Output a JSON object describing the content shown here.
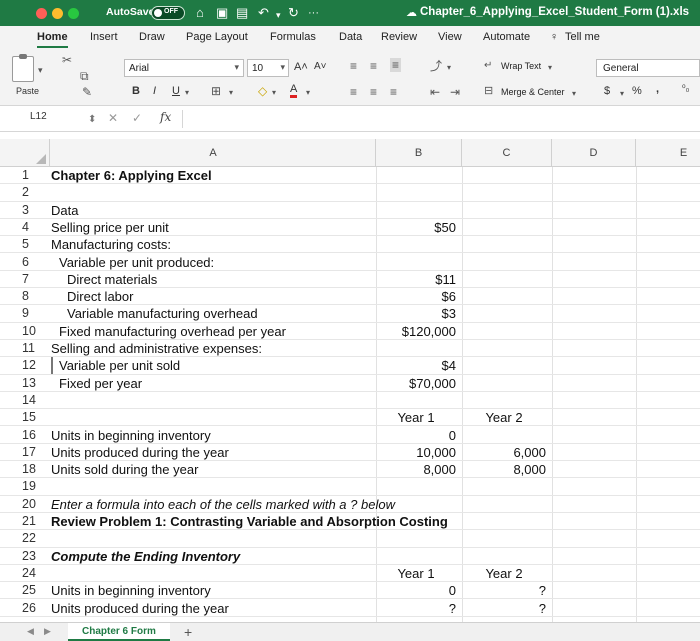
{
  "titlebar": {
    "autosave_label": "AutoSave",
    "autosave_state": "OFF",
    "more": "···",
    "document_title": "Chapter_6_Applying_Excel_Student_Form (1).xls"
  },
  "menu": {
    "tabs": [
      "Home",
      "Insert",
      "Draw",
      "Page Layout",
      "Formulas",
      "Data",
      "Review",
      "View",
      "Automate"
    ],
    "active": "Home",
    "tell_me": "Tell me"
  },
  "ribbon": {
    "paste_label": "Paste",
    "font_name": "Arial",
    "font_size": "10",
    "grow_font": "A˄",
    "shrink_font": "A˅",
    "bold": "B",
    "italic": "I",
    "underline": "U",
    "font_color": "A",
    "wrap_text": "Wrap Text",
    "merge_center": "Merge & Center",
    "number_format": "General",
    "currency": "$",
    "percent": "%",
    "comma": ",",
    "inc_decimal": "⁰₀"
  },
  "formula_bar": {
    "name_box": "L12",
    "fx": "fx"
  },
  "columns": [
    "A",
    "B",
    "C",
    "D",
    "E"
  ],
  "rows": [
    {
      "n": "1",
      "a": "Chapter 6: Applying Excel",
      "b": "",
      "c": "",
      "a_style": "bold"
    },
    {
      "n": "2",
      "a": "",
      "b": "",
      "c": ""
    },
    {
      "n": "3",
      "a": "Data",
      "b": "",
      "c": ""
    },
    {
      "n": "4",
      "a": "Selling price per unit",
      "b": "$50",
      "c": ""
    },
    {
      "n": "5",
      "a": "Manufacturing costs:",
      "b": "",
      "c": ""
    },
    {
      "n": "6",
      "a": "Variable per unit produced:",
      "b": "",
      "c": "",
      "indent": 1
    },
    {
      "n": "7",
      "a": "Direct materials",
      "b": "$11",
      "c": "",
      "indent": 2
    },
    {
      "n": "8",
      "a": "Direct labor",
      "b": "$6",
      "c": "",
      "indent": 2
    },
    {
      "n": "9",
      "a": "Variable manufacturing overhead",
      "b": "$3",
      "c": "",
      "indent": 2
    },
    {
      "n": "10",
      "a": "Fixed manufacturing overhead per year",
      "b": "$120,000",
      "c": "",
      "indent": 1
    },
    {
      "n": "11",
      "a": "Selling and administrative expenses:",
      "b": "",
      "c": ""
    },
    {
      "n": "12",
      "a": "Variable per unit sold",
      "b": "$4",
      "c": "",
      "indent": 1
    },
    {
      "n": "13",
      "a": "Fixed per year",
      "b": "$70,000",
      "c": "",
      "indent": 1
    },
    {
      "n": "14",
      "a": "",
      "b": "",
      "c": ""
    },
    {
      "n": "15",
      "a": "",
      "b": "Year 1",
      "c": "Year 2",
      "center": true
    },
    {
      "n": "16",
      "a": "Units in beginning inventory",
      "b": "0",
      "c": ""
    },
    {
      "n": "17",
      "a": "Units produced during the year",
      "b": "10,000",
      "c": "6,000"
    },
    {
      "n": "18",
      "a": "Units sold during the year",
      "b": "8,000",
      "c": "8,000"
    },
    {
      "n": "19",
      "a": "",
      "b": "",
      "c": ""
    },
    {
      "n": "20",
      "a": "Enter a formula into each of the cells marked with a ? below",
      "b": "",
      "c": "",
      "a_style": "ital"
    },
    {
      "n": "21",
      "a": "Review Problem 1: Contrasting Variable and Absorption Costing",
      "b": "",
      "c": "",
      "a_style": "bold"
    },
    {
      "n": "22",
      "a": "",
      "b": "",
      "c": ""
    },
    {
      "n": "23",
      "a": "Compute the Ending Inventory",
      "b": "",
      "c": "",
      "a_style": "bold-ital"
    },
    {
      "n": "24",
      "a": "",
      "b": "Year 1",
      "c": "Year 2",
      "center": true
    },
    {
      "n": "25",
      "a": "Units in beginning inventory",
      "b": "0",
      "c": "?"
    },
    {
      "n": "26",
      "a": "Units produced during the year",
      "b": "?",
      "c": "?"
    }
  ],
  "sheet_tabs": {
    "active": "Chapter 6 Form",
    "add": "+"
  }
}
